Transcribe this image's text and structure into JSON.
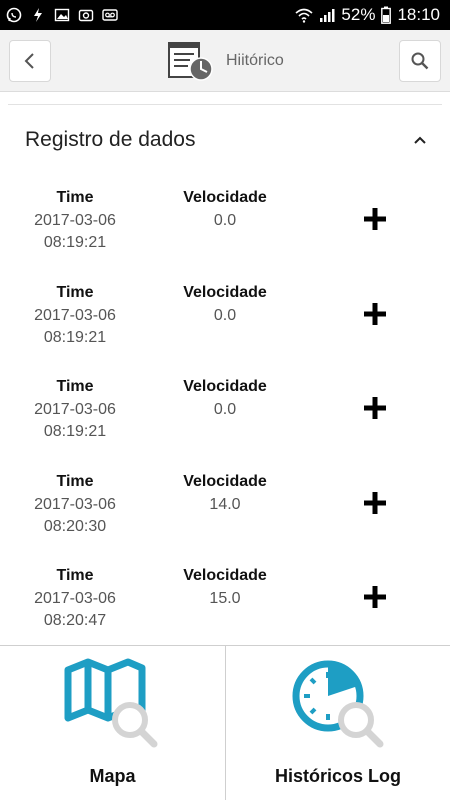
{
  "status_bar": {
    "battery": "52%",
    "time": "18:10",
    "icons": [
      "whatsapp-icon",
      "flash-icon",
      "image-icon",
      "camera-icon",
      "voicemail-icon",
      "wifi-icon",
      "signal-icon",
      "battery-icon"
    ]
  },
  "header": {
    "title": "Hiitórico",
    "back_icon": "chevron-left-icon",
    "search_icon": "search-icon",
    "logo_icon": "history-report-icon"
  },
  "section": {
    "title": "Registro de dados",
    "collapse_icon": "chevron-up-icon"
  },
  "records": [
    {
      "time_label": "Time",
      "date": "2017-03-06",
      "clock": "08:19:21",
      "speed_label": "Velocidade",
      "speed": "0.0"
    },
    {
      "time_label": "Time",
      "date": "2017-03-06",
      "clock": "08:19:21",
      "speed_label": "Velocidade",
      "speed": "0.0"
    },
    {
      "time_label": "Time",
      "date": "2017-03-06",
      "clock": "08:19:21",
      "speed_label": "Velocidade",
      "speed": "0.0"
    },
    {
      "time_label": "Time",
      "date": "2017-03-06",
      "clock": "08:20:30",
      "speed_label": "Velocidade",
      "speed": "14.0"
    },
    {
      "time_label": "Time",
      "date": "2017-03-06",
      "clock": "08:20:47",
      "speed_label": "Velocidade",
      "speed": "15.0"
    }
  ],
  "bottom_nav": [
    {
      "label": "Mapa",
      "icon": "map-search-icon"
    },
    {
      "label": "Históricos Log",
      "icon": "clock-search-icon"
    }
  ],
  "colors": {
    "accent": "#1e9ec4",
    "magnifier": "#d4d4d4",
    "header_bg": "#f2f2f2"
  }
}
